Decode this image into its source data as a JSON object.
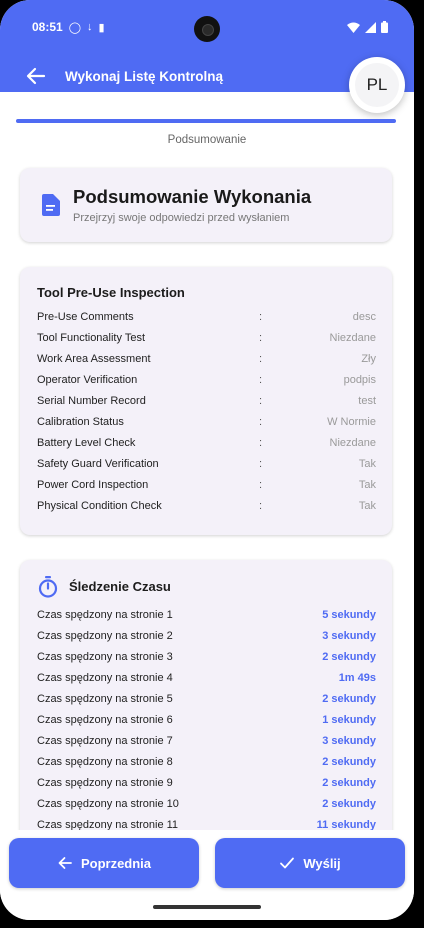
{
  "status_bar": {
    "time": "08:51"
  },
  "appbar": {
    "title": "Wykonaj Listę Kontrolną",
    "avatar_initials": "PL",
    "accent": "#4f6bf3"
  },
  "progress": {
    "step_label": "Podsumowanie",
    "fraction": 1.0
  },
  "summary": {
    "title": "Podsumowanie Wykonania",
    "subtitle": "Przejrzyj swoje odpowiedzi przed wysłaniem"
  },
  "inspection": {
    "title": "Tool Pre-Use Inspection",
    "separator": ":",
    "rows": [
      {
        "label": "Pre-Use Comments",
        "value": "desc"
      },
      {
        "label": "Tool Functionality Test",
        "value": "Niezdane"
      },
      {
        "label": "Work Area Assessment",
        "value": "Zły"
      },
      {
        "label": "Operator Verification",
        "value": "podpis"
      },
      {
        "label": "Serial Number Record",
        "value": "test"
      },
      {
        "label": "Calibration Status",
        "value": "W Normie"
      },
      {
        "label": "Battery Level Check",
        "value": "Niezdane"
      },
      {
        "label": "Safety Guard Verification",
        "value": "Tak"
      },
      {
        "label": "Power Cord Inspection",
        "value": "Tak"
      },
      {
        "label": "Physical Condition Check",
        "value": "Tak"
      }
    ]
  },
  "timing": {
    "title": "Śledzenie Czasu",
    "rows": [
      {
        "label": "Czas spędzony na stronie 1",
        "value": "5 sekundy"
      },
      {
        "label": "Czas spędzony na stronie 2",
        "value": "3 sekundy"
      },
      {
        "label": "Czas spędzony na stronie 3",
        "value": "2 sekundy"
      },
      {
        "label": "Czas spędzony na stronie 4",
        "value": "1m 49s"
      },
      {
        "label": "Czas spędzony na stronie 5",
        "value": "2 sekundy"
      },
      {
        "label": "Czas spędzony na stronie 6",
        "value": "1 sekundy"
      },
      {
        "label": "Czas spędzony na stronie 7",
        "value": "3 sekundy"
      },
      {
        "label": "Czas spędzony na stronie 8",
        "value": "2 sekundy"
      },
      {
        "label": "Czas spędzony na stronie 9",
        "value": "2 sekundy"
      },
      {
        "label": "Czas spędzony na stronie 10",
        "value": "2 sekundy"
      },
      {
        "label": "Czas spędzony na stronie 11",
        "value": "11 sekundy"
      }
    ]
  },
  "buttons": {
    "previous": "Poprzednia",
    "submit": "Wyślij"
  }
}
